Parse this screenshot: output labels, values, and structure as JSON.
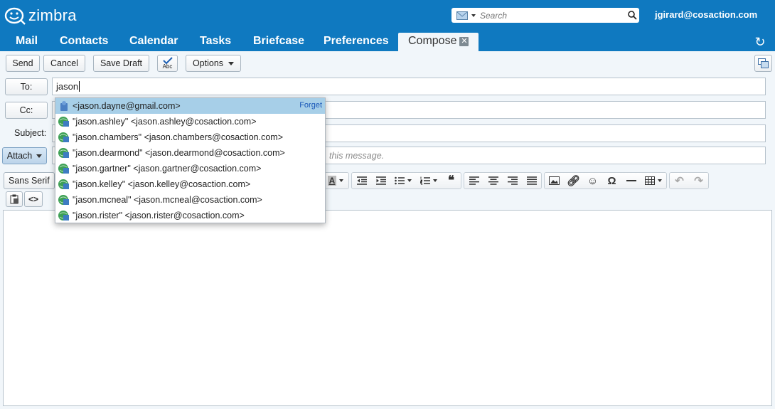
{
  "header": {
    "logo_text": "zimbra",
    "search_placeholder": "Search",
    "user": "jgirard@cosaction.com"
  },
  "tabs": [
    {
      "label": "Mail"
    },
    {
      "label": "Contacts"
    },
    {
      "label": "Calendar"
    },
    {
      "label": "Tasks"
    },
    {
      "label": "Briefcase"
    },
    {
      "label": "Preferences"
    },
    {
      "label": "Compose",
      "active": true
    }
  ],
  "toolbar": {
    "send": "Send",
    "cancel": "Cancel",
    "save_draft": "Save Draft",
    "spell_label": "Abc",
    "options": "Options"
  },
  "compose": {
    "to_label": "To:",
    "to_value": "jason",
    "cc_label": "Cc:",
    "subject_label": "Subject:",
    "attach_label": "Attach",
    "attach_hint": "this message."
  },
  "format_toolbar": {
    "font_family": "Sans Serif"
  },
  "autocomplete": {
    "forget_label": "Forget",
    "items": [
      {
        "text": "<jason.dayne@gmail.com>",
        "selected": true,
        "icon": "contact-local-icon"
      },
      {
        "text": "\"jason.ashley\" <jason.ashley@cosaction.com>",
        "icon": "contact-gal-icon"
      },
      {
        "text": "\"jason.chambers\" <jason.chambers@cosaction.com>",
        "icon": "contact-gal-icon"
      },
      {
        "text": "\"jason.dearmond\" <jason.dearmond@cosaction.com>",
        "icon": "contact-gal-icon"
      },
      {
        "text": "\"jason.gartner\" <jason.gartner@cosaction.com>",
        "icon": "contact-gal-icon"
      },
      {
        "text": "\"jason.kelley\" <jason.kelley@cosaction.com>",
        "icon": "contact-gal-icon"
      },
      {
        "text": "\"jason.mcneal\" <jason.mcneal@cosaction.com>",
        "icon": "contact-gal-icon"
      },
      {
        "text": "\"jason.rister\" <jason.rister@cosaction.com>",
        "icon": "contact-gal-icon"
      }
    ]
  },
  "colors": {
    "brand_blue": "#0f79c0",
    "selection": "#a7cfe8",
    "link": "#1957b8"
  }
}
